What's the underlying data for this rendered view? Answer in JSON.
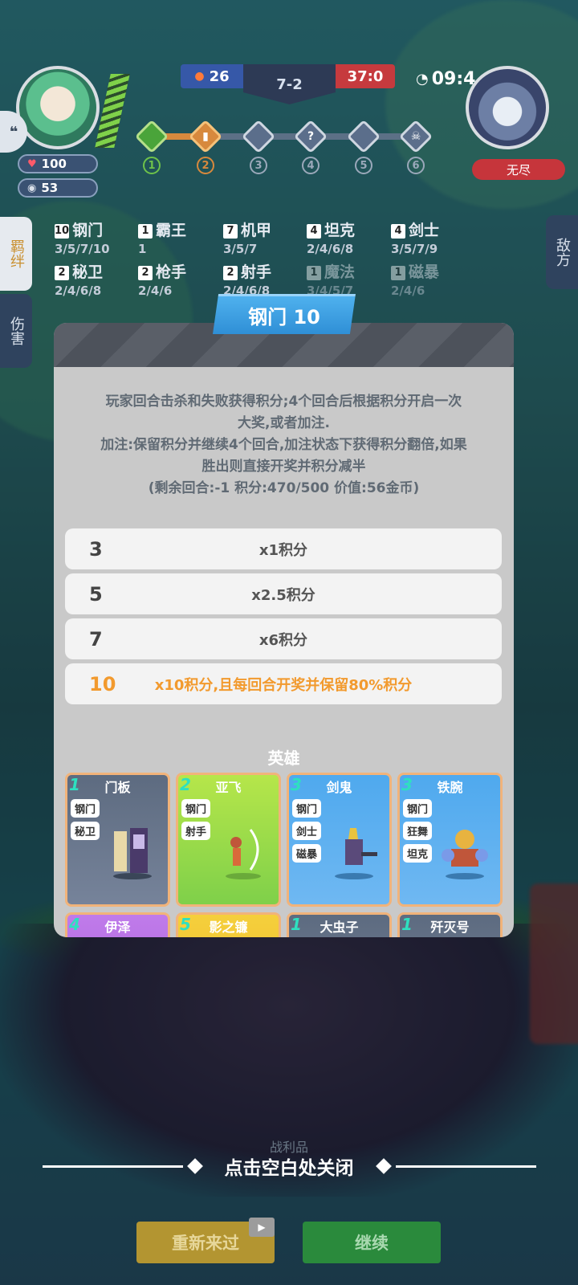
{
  "hud": {
    "hp": "100",
    "gold": "53",
    "score_left": "26",
    "round": "7-2",
    "score_right": "37:0",
    "timer": "09:4",
    "enemy_label": "无尽",
    "stages": [
      "1",
      "2",
      "3",
      "4",
      "5",
      "6"
    ]
  },
  "side_tabs": {
    "left": [
      "羁绊",
      "伤害"
    ],
    "right": "敌方"
  },
  "synergies": [
    {
      "count": "10",
      "name": "钢门",
      "levels": "3/5/7/10"
    },
    {
      "count": "1",
      "name": "霸王",
      "levels": "1"
    },
    {
      "count": "7",
      "name": "机甲",
      "levels": "3/5/7"
    },
    {
      "count": "4",
      "name": "坦克",
      "levels": "2/4/6/8"
    },
    {
      "count": "4",
      "name": "剑士",
      "levels": "3/5/7/9"
    },
    {
      "count": "2",
      "name": "秘卫",
      "levels": "2/4/6/8"
    },
    {
      "count": "2",
      "name": "枪手",
      "levels": "2/4/6"
    },
    {
      "count": "2",
      "name": "射手",
      "levels": "2/4/6/8"
    },
    {
      "count": "1",
      "name": "魔法",
      "levels": "3/4/5/7"
    },
    {
      "count": "1",
      "name": "磁暴",
      "levels": "2/4/6"
    }
  ],
  "modal": {
    "title": "钢门 10",
    "description_lines": [
      "玩家回合击杀和失败获得积分;4个回合后根据积分开启一次",
      "大奖,或者加注.",
      "加注:保留积分并继续4个回合,加注状态下获得积分翻倍,如果",
      "胜出则直接开奖并积分减半",
      "(剩余回合:-1 积分:470/500 价值:56金币)"
    ],
    "tiers": [
      {
        "level": "3",
        "text": "x1积分"
      },
      {
        "level": "5",
        "text": "x2.5积分"
      },
      {
        "level": "7",
        "text": "x6积分"
      },
      {
        "level": "10",
        "text": "x10积分,且每回合开奖并保留80%积分"
      }
    ],
    "heroes_title": "英雄",
    "heroes": [
      {
        "cost": "1",
        "name": "门板",
        "traits": [
          "钢门",
          "秘卫"
        ]
      },
      {
        "cost": "2",
        "name": "亚飞",
        "traits": [
          "钢门",
          "射手"
        ]
      },
      {
        "cost": "3",
        "name": "剑鬼",
        "traits": [
          "钢门",
          "剑士",
          "磁暴"
        ]
      },
      {
        "cost": "3",
        "name": "铁腕",
        "traits": [
          "钢门",
          "狂舞",
          "坦克"
        ]
      },
      {
        "cost": "4",
        "name": "伊泽",
        "traits": []
      },
      {
        "cost": "5",
        "name": "影之镰",
        "traits": []
      },
      {
        "cost": "1",
        "name": "大虫子",
        "traits": []
      },
      {
        "cost": "1",
        "name": "歼灭号",
        "traits": []
      }
    ]
  },
  "footer": {
    "close_hint": "点击空白处关闭",
    "faint_label": "战利品",
    "retry_button": "重新来过",
    "continue_button": "继续"
  },
  "colors": {
    "modal_bg": "#c9c9c9",
    "title_banner": "#3fa2e6",
    "highlight": "#f29a2e",
    "retry": "#b39531",
    "continue": "#2a8a3c"
  }
}
